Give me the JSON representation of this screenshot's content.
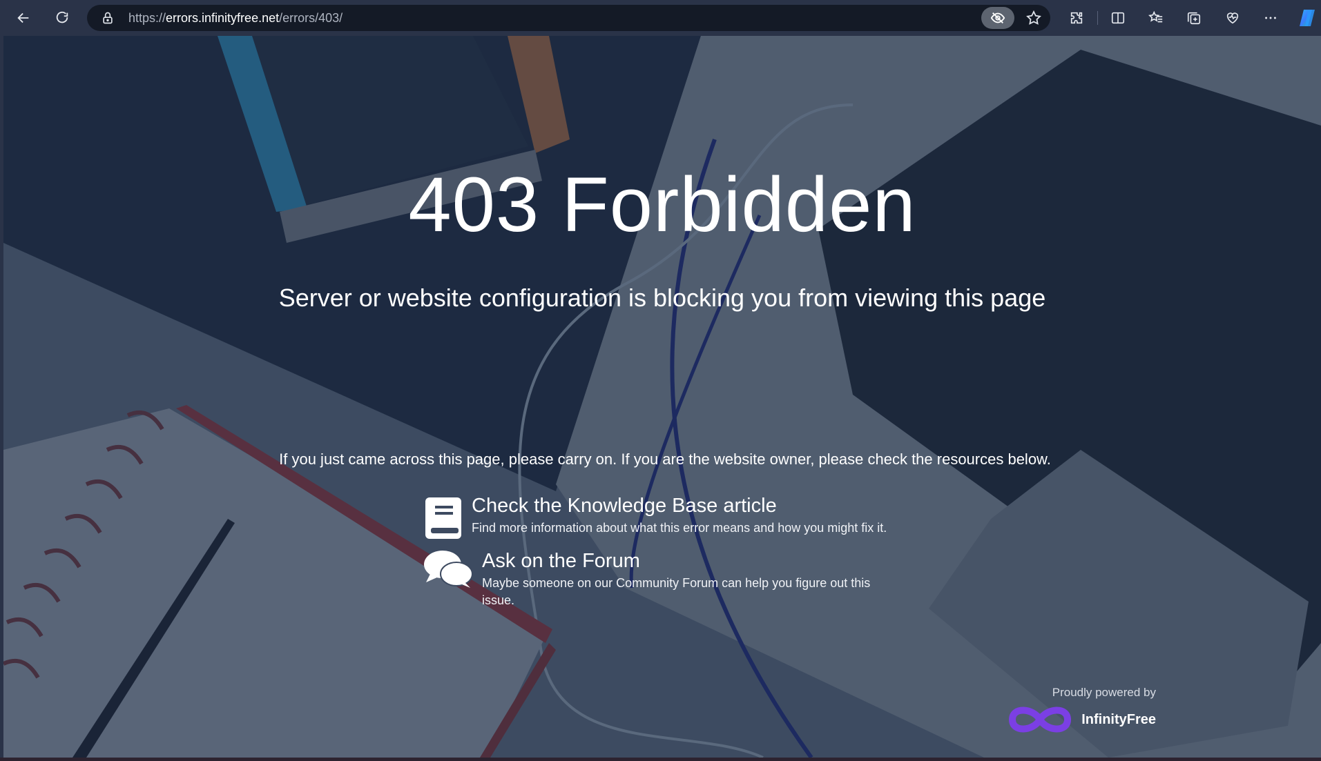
{
  "browser": {
    "url_prefix": "https://",
    "url_host": "errors.infinityfree.net",
    "url_path": "/errors/403/"
  },
  "page": {
    "title": "403 Forbidden",
    "subtitle": "Server or website configuration is blocking you from viewing this page",
    "intro": "If you just came across this page, please carry on. If you are the website owner, please check the resources below.",
    "resources": [
      {
        "title": "Check the Knowledge Base article",
        "description": "Find more information about what this error means and how you might fix it.",
        "icon": "book-icon"
      },
      {
        "title": "Ask on the Forum",
        "description": "Maybe someone on our Community Forum can help you figure out this issue.",
        "icon": "chat-bubbles-icon"
      }
    ],
    "powered_by": "Proudly powered by",
    "brand": "InfinityFree"
  },
  "colors": {
    "toolbar": "#2a3348",
    "addressbar": "#141a26",
    "brand_purple": "#7b3fe4",
    "text": "#ffffff"
  }
}
